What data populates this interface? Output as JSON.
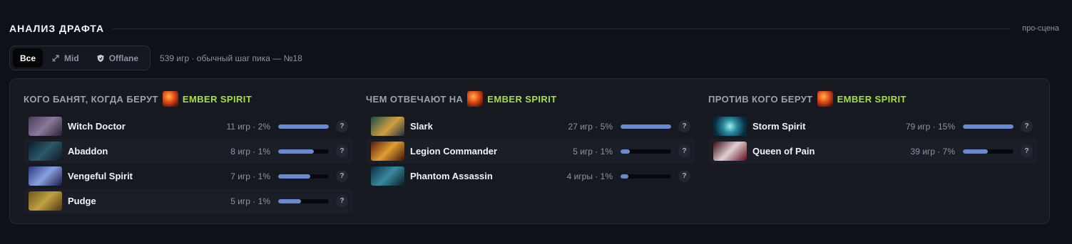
{
  "header": {
    "title": "АНАЛИЗ ДРАФТА",
    "source": "про-сцена"
  },
  "filters": {
    "tabs": [
      {
        "label": "Все",
        "icon": "",
        "active": true
      },
      {
        "label": "Mid",
        "icon": "sword-icon",
        "active": false
      },
      {
        "label": "Offlane",
        "icon": "shield-icon",
        "active": false
      }
    ],
    "summary": "539 игр · обычный шаг пика — №18"
  },
  "colors": {
    "accent": "#a4e23a",
    "bar_fill": "#6a8ad0",
    "bar_track": "#07080b"
  },
  "columns": [
    {
      "heading": "КОГО БАНЯТ, КОГДА БЕРУТ",
      "hero": "EMBER SPIRIT",
      "rows": [
        {
          "name": "Witch Doctor",
          "stat": "11 игр · 2%",
          "fill": 1.0
        },
        {
          "name": "Abaddon",
          "stat": "8 игр · 1%",
          "fill": 0.71
        },
        {
          "name": "Vengeful Spirit",
          "stat": "7 игр · 1%",
          "fill": 0.63
        },
        {
          "name": "Pudge",
          "stat": "5 игр · 1%",
          "fill": 0.45
        }
      ]
    },
    {
      "heading": "ЧЕМ ОТВЕЧАЮТ НА",
      "hero": "EMBER SPIRIT",
      "rows": [
        {
          "name": "Slark",
          "stat": "27 игр · 5%",
          "fill": 1.0
        },
        {
          "name": "Legion Commander",
          "stat": "5 игр · 1%",
          "fill": 0.18
        },
        {
          "name": "Phantom Assassin",
          "stat": "4 игры · 1%",
          "fill": 0.15
        }
      ]
    },
    {
      "heading": "ПРОТИВ КОГО БЕРУТ",
      "hero": "EMBER SPIRIT",
      "rows": [
        {
          "name": "Storm Spirit",
          "stat": "79 игр · 15%",
          "fill": 1.0
        },
        {
          "name": "Queen of Pain",
          "stat": "39 игр · 7%",
          "fill": 0.49
        }
      ]
    }
  ],
  "help_label": "?"
}
